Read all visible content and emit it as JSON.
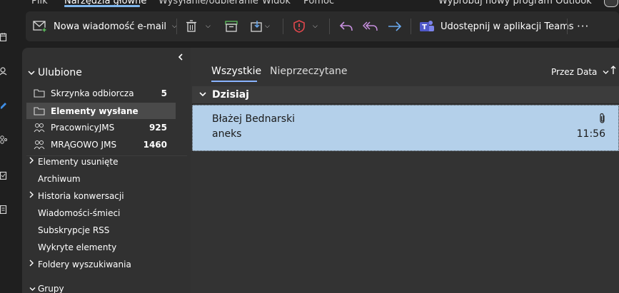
{
  "menu": {
    "items": [
      "Plik",
      "Narzędzia główne",
      "Wysyłanie/odbieranie",
      "Widok",
      "Pomoc"
    ],
    "active": "Narzędzia główne",
    "try_new": "Wypróbuj nowy program Outlook"
  },
  "ribbon": {
    "new_email_label": "Nowa wiadomość e-mail",
    "teams_label": "Udostępnij w aplikacji Teams",
    "more_label": "···",
    "icons": [
      "new-mail-icon",
      "delete-icon",
      "archive-icon",
      "move-icon",
      "report-icon",
      "reply-icon",
      "reply-all-icon",
      "forward-icon",
      "teams-icon"
    ]
  },
  "folders": {
    "favorites_title": "Ulubione",
    "favorites": [
      {
        "label": "Skrzynka odbiorcza",
        "count": "5",
        "icon": "folder-icon"
      },
      {
        "label": "Elementy wysłane",
        "count": "",
        "icon": "folder-icon",
        "selected": true
      },
      {
        "label": "PracownicyJMS",
        "count": "925",
        "icon": "group-icon"
      },
      {
        "label": "MRĄGOWO JMS",
        "count": "1460",
        "icon": "group-icon"
      }
    ],
    "tree": [
      {
        "label": "Elementy usunięte",
        "expandable": true
      },
      {
        "label": "Archiwum",
        "expandable": false
      },
      {
        "label": "Historia konwersacji",
        "expandable": true
      },
      {
        "label": "Wiadomości-śmieci",
        "expandable": false
      },
      {
        "label": "Subskrypcje RSS",
        "expandable": false
      },
      {
        "label": "Wykryte elementy",
        "expandable": false
      },
      {
        "label": "Foldery wyszukiwania",
        "expandable": true
      }
    ],
    "groups_title": "Grupy"
  },
  "list": {
    "tabs": [
      "Wszystkie",
      "Nieprzeczytane"
    ],
    "active_tab": "Wszystkie",
    "sort_label": "Przez Data",
    "group_header": "Dzisiaj",
    "messages": [
      {
        "sender": "Błażej Bednarski",
        "subject": "aneks",
        "time": "11:56",
        "has_attachment": true,
        "selected": true
      }
    ]
  },
  "colors": {
    "accent": "#8ab4ff",
    "selected_message_bg": "#b4d0ea",
    "report_red": "#e0474c",
    "reply_purple": "#c890e0",
    "forward_blue": "#6aa9ef",
    "teams_purple": "#6264a7"
  }
}
